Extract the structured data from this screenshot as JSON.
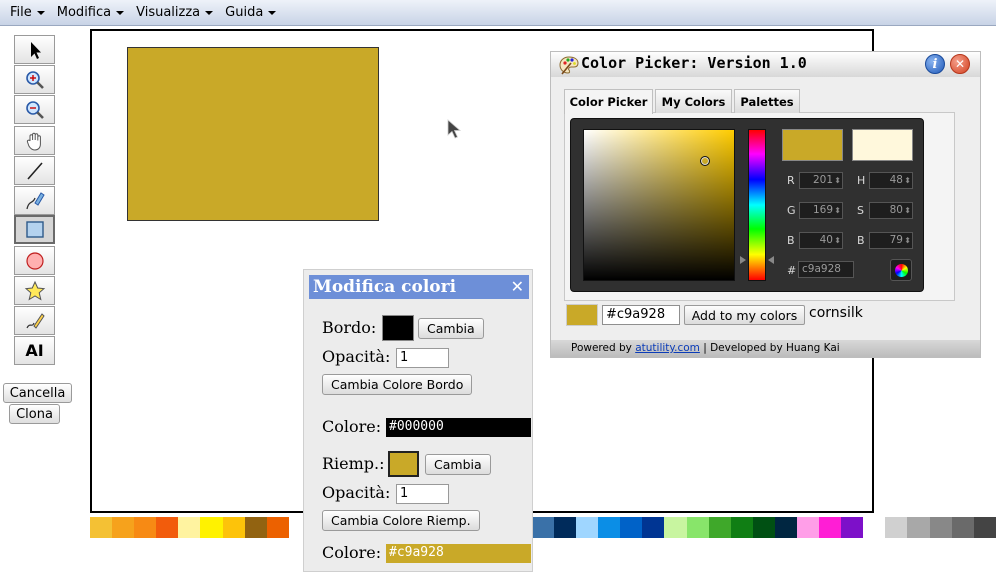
{
  "menu": {
    "items": [
      {
        "label": "File"
      },
      {
        "label": "Modifica"
      },
      {
        "label": "Visualizza"
      },
      {
        "label": "Guida"
      }
    ]
  },
  "tools": {
    "items": [
      {
        "icon": "pointer-icon"
      },
      {
        "icon": "zoom-in-icon"
      },
      {
        "icon": "zoom-out-icon"
      },
      {
        "icon": "hand-icon"
      },
      {
        "icon": "line-icon"
      },
      {
        "icon": "pen-icon"
      },
      {
        "icon": "rectangle-icon",
        "active": true
      },
      {
        "icon": "ellipse-icon"
      },
      {
        "icon": "star-icon"
      },
      {
        "icon": "pencil-icon"
      },
      {
        "icon": "text-icon",
        "glyph": "AI"
      }
    ],
    "cancel_label": "Cancella",
    "clone_label": "Clona"
  },
  "canvas": {
    "shape_fill": "#c9a928",
    "shape_stroke": "#333333"
  },
  "palette": {
    "colors": [
      "#f4c134",
      "#f6a21c",
      "#f78a14",
      "#f25c0c",
      "#fff3a0",
      "#fff200",
      "#fdc30a",
      "#926311",
      "#ec6100",
      "#ffffff",
      "#ffffff",
      "#ffffff",
      "#ffffff",
      "#ffffff",
      "#ffffff",
      "#ffffff",
      "#ffffff",
      "#ffffff",
      "#ffffff",
      "#ffffff",
      "#3a71a8",
      "#002b5b",
      "#9fd6ff",
      "#0b8ee6",
      "#0062c8",
      "#003593",
      "#c8f5a0",
      "#88e56a",
      "#3fa82a",
      "#107e14",
      "#005013",
      "#002641",
      "#ff9ee8",
      "#ff1ed5",
      "#7d10c9",
      "#ffffff",
      "#d0d0d0",
      "#a8a8a8",
      "#888888",
      "#6a6a6a",
      "#444444"
    ]
  },
  "colors_panel": {
    "title": "Modifica colori",
    "close_glyph": "✕",
    "border_label": "Bordo:",
    "border_color": "#000000",
    "change_label": "Cambia",
    "opacity_label": "Opacità:",
    "border_opacity": "1",
    "change_border_color_label": "Cambia Colore Bordo",
    "color_label": "Colore:",
    "border_hex": "#000000",
    "fill_label": "Riemp.:",
    "fill_color": "#c9a928",
    "fill_opacity": "1",
    "change_fill_color_label": "Cambia Colore Riemp.",
    "fill_hex": "#c9a928"
  },
  "color_picker": {
    "title": "Color Picker: Version 1.0",
    "info_glyph": "i",
    "close_glyph": "✕",
    "tabs": [
      {
        "label": "Color Picker",
        "active": true
      },
      {
        "label": "My Colors",
        "active": false
      },
      {
        "label": "Palettes",
        "active": false
      }
    ],
    "hue_color": "#ffcc00",
    "new_color": "#c9a928",
    "old_color": "#fff8dc",
    "fields": {
      "r_label": "R",
      "r_value": "201",
      "g_label": "G",
      "g_value": "169",
      "b_label": "B",
      "b_value": "40",
      "h_label": "H",
      "h_value": "48",
      "s_label": "S",
      "s_value": "80",
      "v_label": "B",
      "v_value": "79",
      "hex_label": "#",
      "hex_value": "c9a928"
    },
    "hex_input": "#c9a928",
    "add_label": "Add to my colors",
    "color_name": "cornsilk",
    "footer_prefix": "Powered by",
    "footer_link": "atutility.com",
    "footer_suffix": "| Developed by Huang Kai"
  }
}
